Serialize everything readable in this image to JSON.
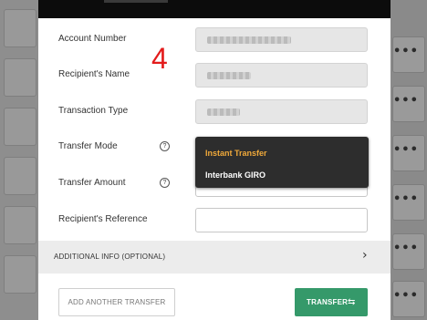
{
  "annotation": "4",
  "form": {
    "account_number_label": "Account Number",
    "recipient_name_label": "Recipient's Name",
    "transaction_type_label": "Transaction Type",
    "transfer_mode_label": "Transfer Mode",
    "transfer_amount_label": "Transfer Amount",
    "recipient_reference_label": "Recipient's Reference"
  },
  "help_icon_glyph": "?",
  "dropdown": {
    "options": [
      {
        "label": "Instant Transfer",
        "color": "#f0a93a"
      },
      {
        "label": "Interbank GIRO",
        "color": "#ffffff"
      }
    ]
  },
  "additional_info": {
    "label": "ADDITIONAL INFO (OPTIONAL)",
    "chevron": "›"
  },
  "buttons": {
    "add_another": "ADD ANOTHER TRANSFER",
    "transfer": "TRANSFER",
    "transfer_icon": "⇆"
  },
  "background": {
    "menu_glyph": "•••"
  },
  "colors": {
    "accent_green": "#35996a",
    "highlight_orange": "#f0a93a",
    "annotation_red": "#e31b1b"
  }
}
